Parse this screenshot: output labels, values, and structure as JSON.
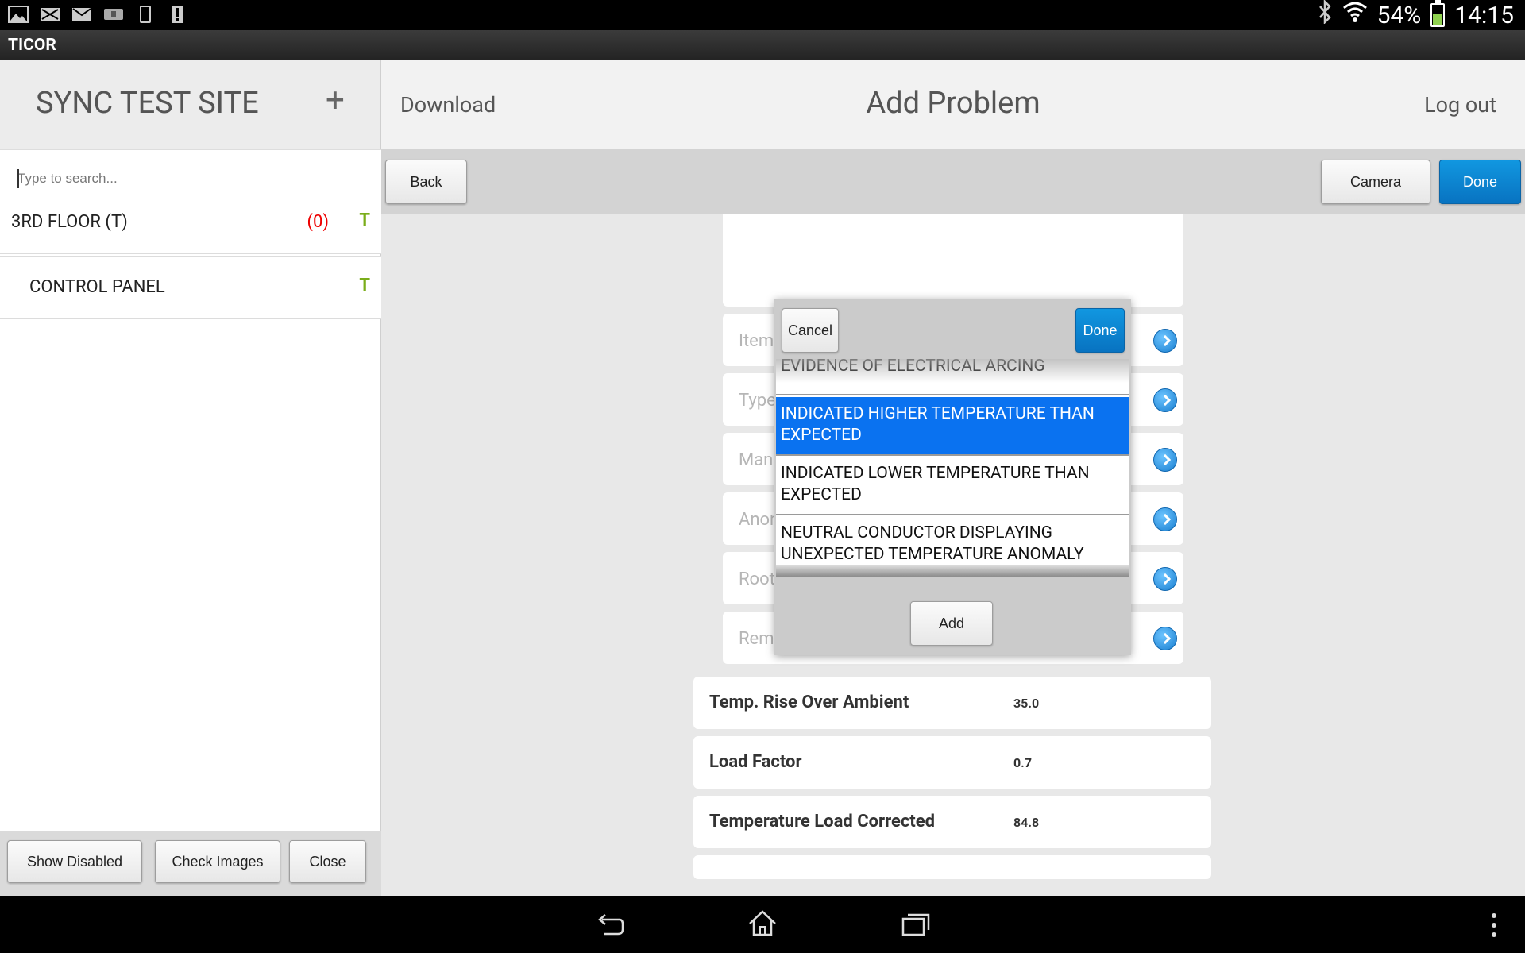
{
  "status_bar": {
    "notification_icons": [
      "gallery-icon",
      "mail-x-icon",
      "mail-icon",
      "drive-icon",
      "phone-icon",
      "alert-file-icon"
    ],
    "battery_percent": "54%",
    "time": "14:15"
  },
  "app": {
    "title": "TICOR"
  },
  "left_panel": {
    "site_name": "SYNC TEST SITE",
    "add_label": "+",
    "search_placeholder": "Type to search...",
    "tree": [
      {
        "label": "3RD FLOOR (T)",
        "count": "(0)",
        "flag": "T"
      },
      {
        "label": "CONTROL PANEL",
        "count": "",
        "flag": "T"
      }
    ],
    "footer_buttons": {
      "show_disabled": "Show Disabled",
      "check_images": "Check Images",
      "close": "Close"
    }
  },
  "header": {
    "download": "Download",
    "title": "Add Problem",
    "logout": "Log out"
  },
  "toolbar": {
    "back": "Back",
    "camera": "Camera",
    "done": "Done"
  },
  "form_fields": [
    {
      "label": "Item"
    },
    {
      "label": "Type"
    },
    {
      "label": "Man"
    },
    {
      "label": "Anon"
    },
    {
      "label": "Root"
    },
    {
      "label": "Rem"
    }
  ],
  "readonly_rows": [
    {
      "label": "Temp. Rise Over Ambient",
      "value": "35.0"
    },
    {
      "label": "Load Factor",
      "value": "0.7"
    },
    {
      "label": "Temperature Load Corrected",
      "value": "84.8"
    }
  ],
  "picker": {
    "cancel": "Cancel",
    "done": "Done",
    "add": "Add",
    "options": [
      {
        "text": "EVIDENCE OF ELECTRICAL ARCING",
        "selected": false
      },
      {
        "text": "INDICATED HIGHER TEMPERATURE THAN EXPECTED",
        "selected": true
      },
      {
        "text": "INDICATED LOWER TEMPERATURE THAN EXPECTED",
        "selected": false
      },
      {
        "text": "NEUTRAL CONDUCTOR DISPLAYING UNEXPECTED TEMPERATURE ANOMALY",
        "selected": false
      }
    ]
  },
  "colors": {
    "accent_blue": "#0a72f0",
    "done_blue": "#0b82cf",
    "count_red": "#e00000",
    "flag_green": "#7aad1a"
  }
}
